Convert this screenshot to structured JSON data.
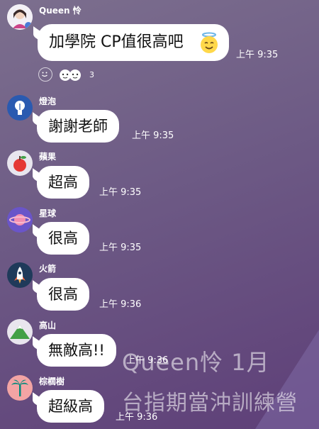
{
  "messages": [
    {
      "name": "Queen 怜",
      "text": "加學院 CP值很高吧",
      "time": "上午 9:35",
      "avatar_icon": "queen-avatar"
    },
    {
      "name": "燈泡",
      "text": "謝謝老師",
      "time": "上午 9:35",
      "avatar_icon": "lightbulb-avatar"
    },
    {
      "name": "蘋果",
      "text": "超高",
      "time": "上午 9:35",
      "avatar_icon": "apple-avatar"
    },
    {
      "name": "星球",
      "text": "很高",
      "time": "上午 9:35",
      "avatar_icon": "planet-avatar"
    },
    {
      "name": "火箭",
      "text": "很高",
      "time": "上午 9:36",
      "avatar_icon": "rocket-avatar"
    },
    {
      "name": "高山",
      "text": "無敵高!!",
      "time": "上午 9:36",
      "avatar_icon": "mountain-avatar"
    },
    {
      "name": "棕櫚樹",
      "text": "超級高",
      "time": "上午 9:36",
      "avatar_icon": "palm-tree-avatar"
    }
  ],
  "reaction": {
    "count": "3",
    "emoji": "smile-icon",
    "stickers": "reaction-stickers"
  },
  "emoji_in_first_bubble": "halo-smile-emoji",
  "watermark": {
    "line1": "Queen怜  1月",
    "line2": "台指期當沖訓練營"
  },
  "colors": {
    "bubble": "#ffffff",
    "background_top": "#7c6f8e",
    "background_bottom": "#5e3f78"
  }
}
